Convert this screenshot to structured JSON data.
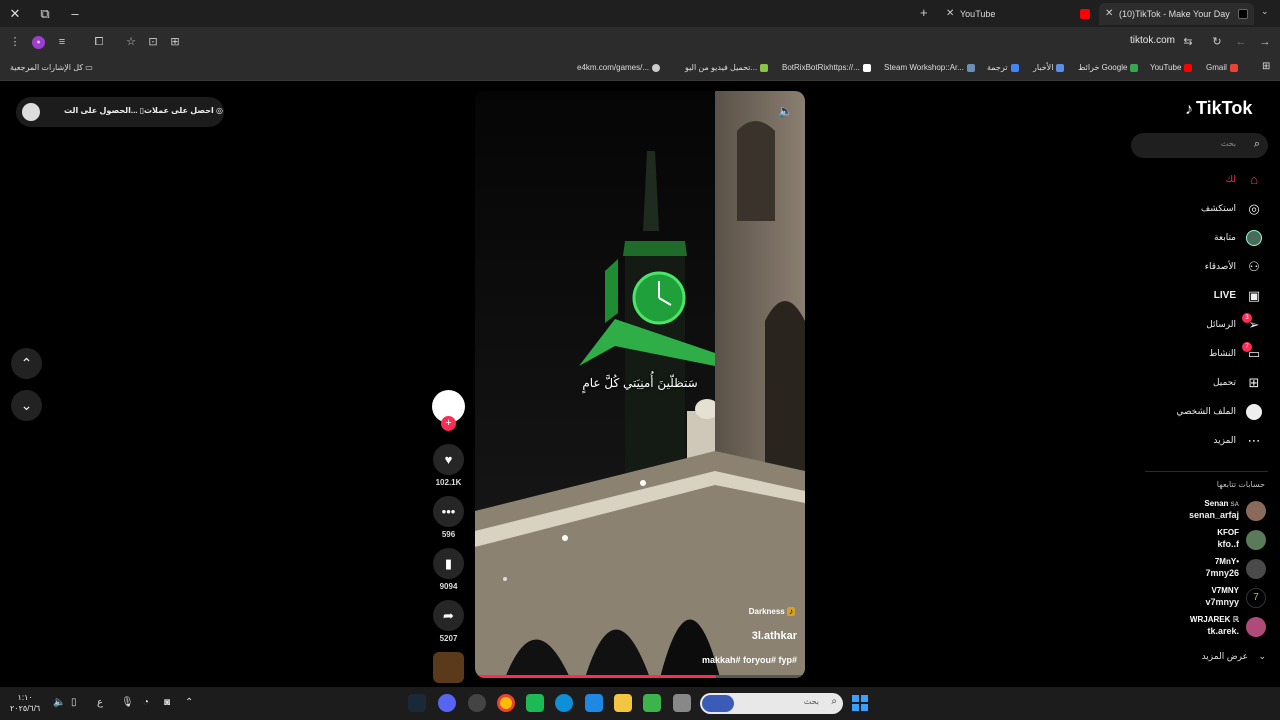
{
  "browser": {
    "tabs": [
      {
        "title": "YouTube",
        "favicon": "youtube-icon",
        "color": "#ff0000",
        "active": false
      },
      {
        "title": "(10)TikTok - Make Your Day",
        "favicon": "tiktok-icon",
        "color": "#000000",
        "active": true
      }
    ],
    "url": "tiktok.com",
    "bookmarks": [
      {
        "label": "e4km.com/games/...",
        "color": "#cccccc"
      },
      {
        "label": "تحميل فيديو من اليو...",
        "color": "#8bc34a"
      },
      {
        "label": "BotRixBotRixhttps://...",
        "color": "#ffffff"
      },
      {
        "label": "Steam Workshop::Ar...",
        "color": "#1b2838"
      },
      {
        "label": "ترجمة",
        "color": "#4285f4"
      },
      {
        "label": "الأخبار",
        "color": "#5c8ee6"
      },
      {
        "label": "خرائط Google",
        "color": "#34a853"
      },
      {
        "label": "YouTube",
        "color": "#ff0000"
      },
      {
        "label": "Gmail",
        "color": "#ea4335"
      }
    ],
    "all_bookmarks": "كل الإشارات المرجعية"
  },
  "promo": {
    "get_coins": "احصل على عملات",
    "get_app": "الحصول على الت..."
  },
  "video": {
    "caption": "سَتظلّينَ أُمنِيَتي كُلَّ عامٍ",
    "music_tag": "Darkness",
    "author": "3l.athkar",
    "hashtags": "makkah# foryou# fyp#",
    "progress": 0.73
  },
  "actions": {
    "likes": "102.1K",
    "comments": "596",
    "saves": "9094",
    "shares": "5207"
  },
  "sidebar": {
    "logo": "TikTok",
    "search_placeholder": "بحث",
    "nav": [
      {
        "label": "لك",
        "icon": "home-icon",
        "glyph": "⌂",
        "active": true
      },
      {
        "label": "استكشف",
        "icon": "compass-icon",
        "glyph": "◎"
      },
      {
        "label": "متابعة",
        "icon": "following-avatar-icon",
        "glyph": "●"
      },
      {
        "label": "الأصدقاء",
        "icon": "friends-icon",
        "glyph": "⚇"
      },
      {
        "label": "LIVE",
        "icon": "live-icon",
        "glyph": "▣"
      },
      {
        "label": "الرسائل",
        "icon": "messages-icon",
        "glyph": "➢",
        "badge": "3"
      },
      {
        "label": "النشاط",
        "icon": "activity-icon",
        "glyph": "▭",
        "badge": "7"
      },
      {
        "label": "تحميل",
        "icon": "upload-icon",
        "glyph": "⊞"
      },
      {
        "label": "الملف الشخصي",
        "icon": "profile-icon",
        "glyph": "○"
      },
      {
        "label": "المزيد",
        "icon": "more-icon",
        "glyph": "⋯"
      }
    ],
    "following_heading": "حسابات تتابعها",
    "following": [
      {
        "name": "Senan",
        "extra": "SA",
        "username": "senan_arfaj"
      },
      {
        "name": "KFOF",
        "username": "kfo..f"
      },
      {
        "name": "7MnY•",
        "username": "7mny26"
      },
      {
        "name": "V7MNY",
        "username": "v7mnyy"
      },
      {
        "name": "WRJAREK ℝ",
        "username": "tk.arek."
      }
    ],
    "see_more": "عرض المزيد"
  },
  "taskbar": {
    "time": "١:١٠",
    "date": "٢٠٢٥/٦/٦",
    "lang": "ع",
    "search_placeholder": "بحث"
  }
}
